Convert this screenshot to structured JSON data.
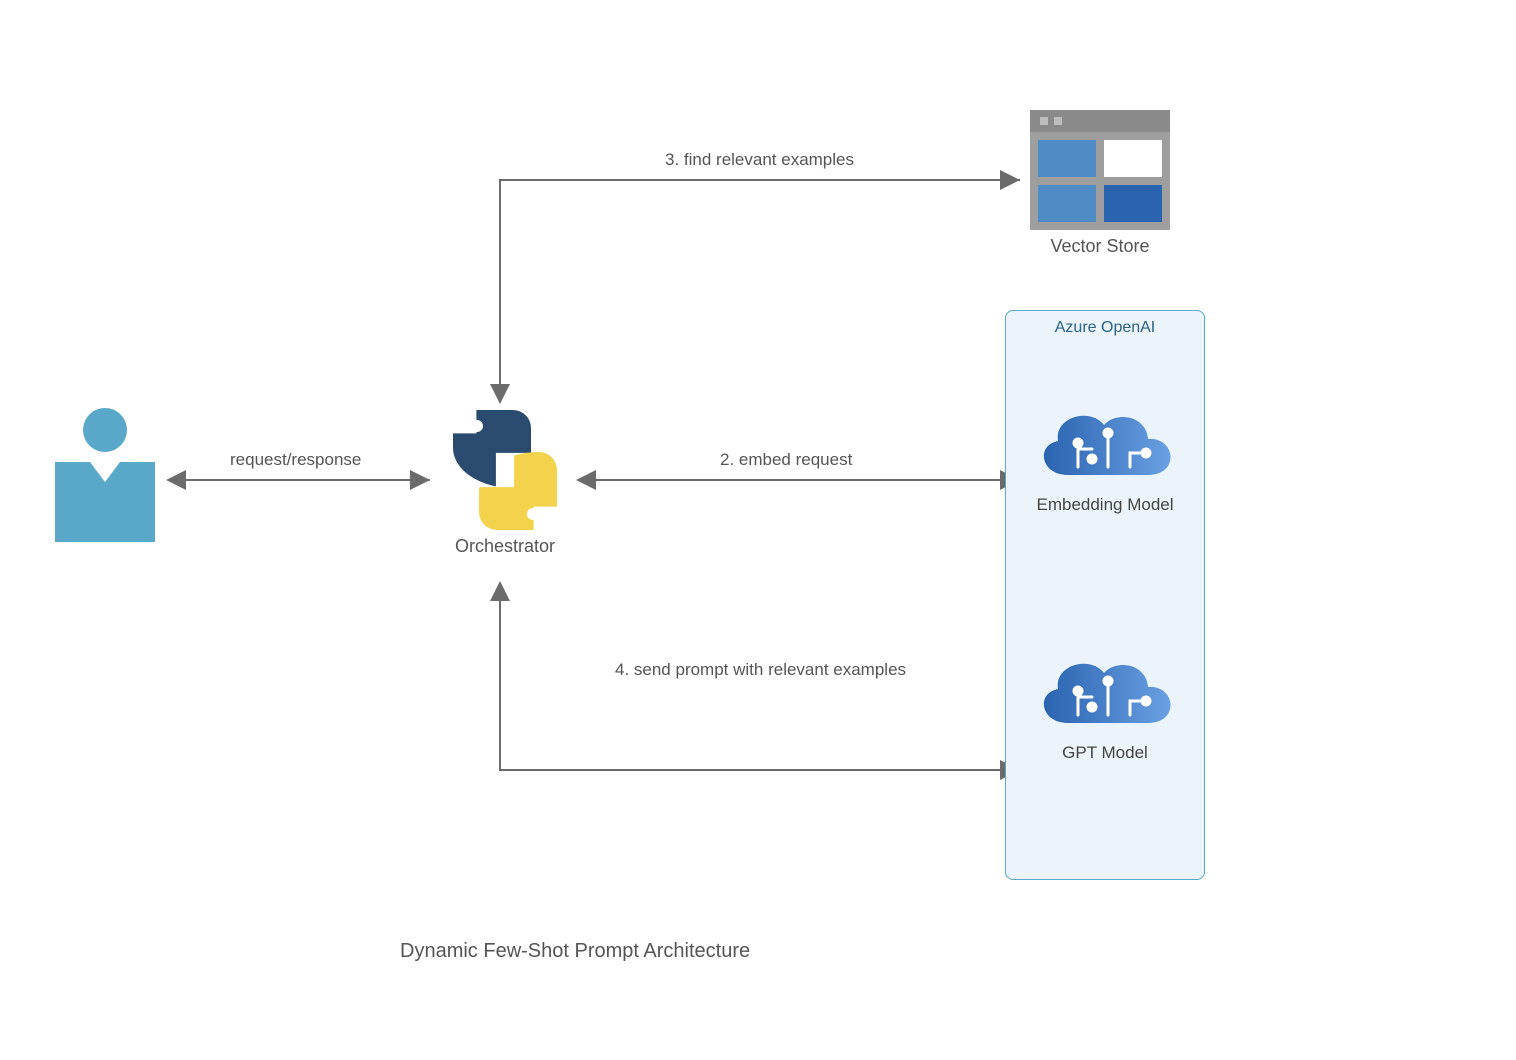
{
  "title": "Dynamic Few-Shot Prompt Architecture",
  "nodes": {
    "user": {
      "label": ""
    },
    "orchestrator": {
      "label": "Orchestrator"
    },
    "vector_store": {
      "label": "Vector Store"
    },
    "azure_openai": {
      "title": "Azure OpenAI",
      "embedding_model": {
        "label": "Embedding Model"
      },
      "gpt_model": {
        "label": "GPT Model"
      }
    }
  },
  "edges": {
    "user_orchestrator": {
      "label": "request/response"
    },
    "orchestrator_embedding": {
      "label": "2. embed request"
    },
    "orchestrator_vectorstore": {
      "label": "3. find relevant examples"
    },
    "orchestrator_gpt": {
      "label": "4. send prompt with relevant examples"
    }
  },
  "colors": {
    "user": "#5aa8c9",
    "python_dark": "#2b4a6f",
    "python_yellow": "#f2d34b",
    "azure_border": "#5aa8c9",
    "azure_bg": "#eaf4fa",
    "cloud_dark": "#2a63b0",
    "cloud_light": "#5a93d6",
    "arrow": "#6b6b6b"
  }
}
